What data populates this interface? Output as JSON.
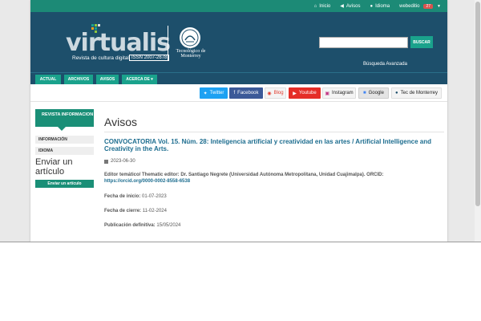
{
  "topbar": {
    "items": [
      {
        "icon": "home-icon",
        "label": "Inicio"
      },
      {
        "icon": "megaphone-icon",
        "label": "Avisos"
      },
      {
        "icon": "globe-icon",
        "label": "Idioma"
      },
      {
        "icon": "user-icon",
        "label": "webeditio",
        "badge": "27"
      }
    ]
  },
  "header": {
    "logo_text": "virtualis",
    "tagline": "Revista de cultura digital",
    "issn": "ISSN 2007-2678",
    "institution": "Tecnológico de Monterrey",
    "search_button": "BUSCAR",
    "search_placeholder": "",
    "advanced_search": "Búsqueda Avanzada"
  },
  "nav": {
    "items": [
      "ACTUAL",
      "ARCHIVOS",
      "AVISOS",
      "ACERCA DE ▾"
    ]
  },
  "social": {
    "items": [
      {
        "label": "Twitter",
        "icon": "twitter-icon"
      },
      {
        "label": "Facebook",
        "icon": "facebook-icon"
      },
      {
        "label": "Blog",
        "icon": "blog-icon"
      },
      {
        "label": "Youtube",
        "icon": "youtube-icon"
      },
      {
        "label": "Instagram",
        "icon": "instagram-icon"
      },
      {
        "label": "Google",
        "icon": "google-icon"
      },
      {
        "label": "Tec de Monterrey",
        "icon": "tec-icon"
      }
    ]
  },
  "sidebar": {
    "heading": "REVISTA INFORMACION",
    "items": [
      "INFORMACIÓN",
      "IDIOMA"
    ],
    "submit_title": "Enviar un artículo",
    "submit_button": "Enviar un artículo"
  },
  "main": {
    "title": "Avisos",
    "announcement": {
      "title": "CONVOCATORIA Vol. 15. Núm. 28: Inteligencia artificial y creatividad en las artes / Artificial Intelligence and Creativity in the Arts.",
      "date": "2023-06-30",
      "editor_label": "Editor temático/ Thematic editor: Dr. Santiago Negrete (Universidad Autónoma Metropolitana, Unidad Cuajimalpa). ORCID:",
      "orcid_link": "https://orcid.org/0000-0002-8558-6538",
      "start_label": "Fecha de inicio:",
      "start_value": "01-07-2023",
      "close_label": "Fecha de cierre:",
      "close_value": "11-02-2024",
      "pub_label": "Publicación definitiva:",
      "pub_value": "15/05/2024"
    }
  },
  "colors": {
    "teal": "#1a8f77",
    "navy": "#1d4f6b",
    "link": "#1d6d8f"
  }
}
